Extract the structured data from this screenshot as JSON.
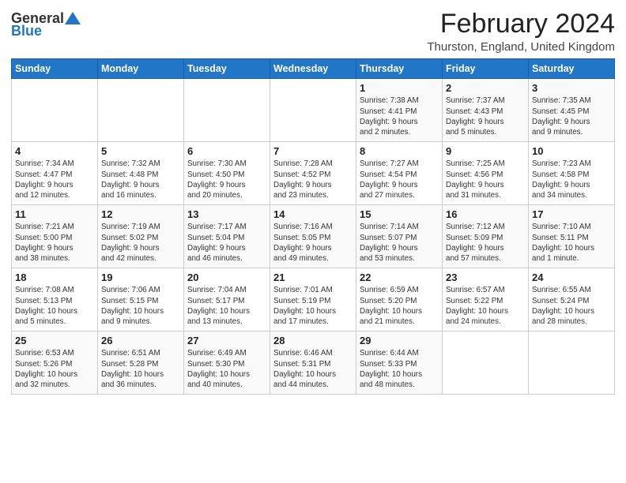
{
  "header": {
    "logo_general": "General",
    "logo_blue": "Blue",
    "title": "February 2024",
    "subtitle": "Thurston, England, United Kingdom"
  },
  "days_of_week": [
    "Sunday",
    "Monday",
    "Tuesday",
    "Wednesday",
    "Thursday",
    "Friday",
    "Saturday"
  ],
  "weeks": [
    [
      {
        "day": "",
        "info": ""
      },
      {
        "day": "",
        "info": ""
      },
      {
        "day": "",
        "info": ""
      },
      {
        "day": "",
        "info": ""
      },
      {
        "day": "1",
        "info": "Sunrise: 7:38 AM\nSunset: 4:41 PM\nDaylight: 9 hours\nand 2 minutes."
      },
      {
        "day": "2",
        "info": "Sunrise: 7:37 AM\nSunset: 4:43 PM\nDaylight: 9 hours\nand 5 minutes."
      },
      {
        "day": "3",
        "info": "Sunrise: 7:35 AM\nSunset: 4:45 PM\nDaylight: 9 hours\nand 9 minutes."
      }
    ],
    [
      {
        "day": "4",
        "info": "Sunrise: 7:34 AM\nSunset: 4:47 PM\nDaylight: 9 hours\nand 12 minutes."
      },
      {
        "day": "5",
        "info": "Sunrise: 7:32 AM\nSunset: 4:48 PM\nDaylight: 9 hours\nand 16 minutes."
      },
      {
        "day": "6",
        "info": "Sunrise: 7:30 AM\nSunset: 4:50 PM\nDaylight: 9 hours\nand 20 minutes."
      },
      {
        "day": "7",
        "info": "Sunrise: 7:28 AM\nSunset: 4:52 PM\nDaylight: 9 hours\nand 23 minutes."
      },
      {
        "day": "8",
        "info": "Sunrise: 7:27 AM\nSunset: 4:54 PM\nDaylight: 9 hours\nand 27 minutes."
      },
      {
        "day": "9",
        "info": "Sunrise: 7:25 AM\nSunset: 4:56 PM\nDaylight: 9 hours\nand 31 minutes."
      },
      {
        "day": "10",
        "info": "Sunrise: 7:23 AM\nSunset: 4:58 PM\nDaylight: 9 hours\nand 34 minutes."
      }
    ],
    [
      {
        "day": "11",
        "info": "Sunrise: 7:21 AM\nSunset: 5:00 PM\nDaylight: 9 hours\nand 38 minutes."
      },
      {
        "day": "12",
        "info": "Sunrise: 7:19 AM\nSunset: 5:02 PM\nDaylight: 9 hours\nand 42 minutes."
      },
      {
        "day": "13",
        "info": "Sunrise: 7:17 AM\nSunset: 5:04 PM\nDaylight: 9 hours\nand 46 minutes."
      },
      {
        "day": "14",
        "info": "Sunrise: 7:16 AM\nSunset: 5:05 PM\nDaylight: 9 hours\nand 49 minutes."
      },
      {
        "day": "15",
        "info": "Sunrise: 7:14 AM\nSunset: 5:07 PM\nDaylight: 9 hours\nand 53 minutes."
      },
      {
        "day": "16",
        "info": "Sunrise: 7:12 AM\nSunset: 5:09 PM\nDaylight: 9 hours\nand 57 minutes."
      },
      {
        "day": "17",
        "info": "Sunrise: 7:10 AM\nSunset: 5:11 PM\nDaylight: 10 hours\nand 1 minute."
      }
    ],
    [
      {
        "day": "18",
        "info": "Sunrise: 7:08 AM\nSunset: 5:13 PM\nDaylight: 10 hours\nand 5 minutes."
      },
      {
        "day": "19",
        "info": "Sunrise: 7:06 AM\nSunset: 5:15 PM\nDaylight: 10 hours\nand 9 minutes."
      },
      {
        "day": "20",
        "info": "Sunrise: 7:04 AM\nSunset: 5:17 PM\nDaylight: 10 hours\nand 13 minutes."
      },
      {
        "day": "21",
        "info": "Sunrise: 7:01 AM\nSunset: 5:19 PM\nDaylight: 10 hours\nand 17 minutes."
      },
      {
        "day": "22",
        "info": "Sunrise: 6:59 AM\nSunset: 5:20 PM\nDaylight: 10 hours\nand 21 minutes."
      },
      {
        "day": "23",
        "info": "Sunrise: 6:57 AM\nSunset: 5:22 PM\nDaylight: 10 hours\nand 24 minutes."
      },
      {
        "day": "24",
        "info": "Sunrise: 6:55 AM\nSunset: 5:24 PM\nDaylight: 10 hours\nand 28 minutes."
      }
    ],
    [
      {
        "day": "25",
        "info": "Sunrise: 6:53 AM\nSunset: 5:26 PM\nDaylight: 10 hours\nand 32 minutes."
      },
      {
        "day": "26",
        "info": "Sunrise: 6:51 AM\nSunset: 5:28 PM\nDaylight: 10 hours\nand 36 minutes."
      },
      {
        "day": "27",
        "info": "Sunrise: 6:49 AM\nSunset: 5:30 PM\nDaylight: 10 hours\nand 40 minutes."
      },
      {
        "day": "28",
        "info": "Sunrise: 6:46 AM\nSunset: 5:31 PM\nDaylight: 10 hours\nand 44 minutes."
      },
      {
        "day": "29",
        "info": "Sunrise: 6:44 AM\nSunset: 5:33 PM\nDaylight: 10 hours\nand 48 minutes."
      },
      {
        "day": "",
        "info": ""
      },
      {
        "day": "",
        "info": ""
      }
    ]
  ]
}
